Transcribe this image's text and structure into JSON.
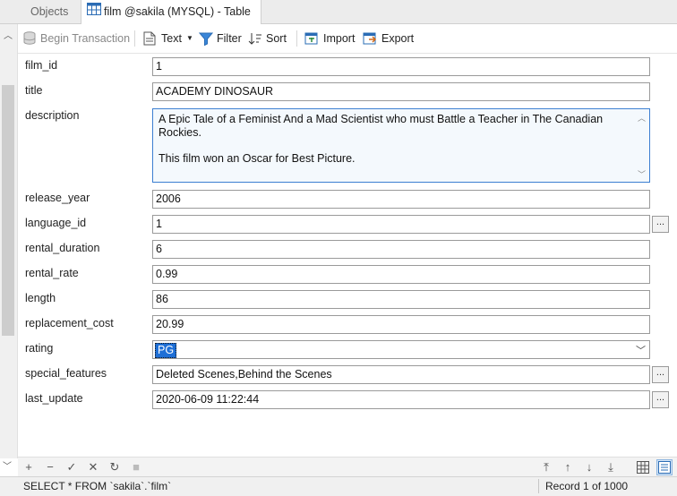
{
  "tabs": {
    "objects": "Objects",
    "film": "film @sakila (MYSQL) - Table"
  },
  "toolbar": {
    "begin_transaction": "Begin Transaction",
    "text": "Text",
    "filter": "Filter",
    "sort": "Sort",
    "import": "Import",
    "export": "Export"
  },
  "fields": {
    "film_id": {
      "label": "film_id",
      "value": "1"
    },
    "title": {
      "label": "title",
      "value": "ACADEMY DINOSAUR"
    },
    "description": {
      "label": "description",
      "line1": "A Epic Tale of a Feminist And a Mad Scientist who must Battle a Teacher in The Canadian Rockies.",
      "line2": "This film won an Oscar for Best Picture."
    },
    "release_year": {
      "label": "release_year",
      "value": "2006"
    },
    "language_id": {
      "label": "language_id",
      "value": "1"
    },
    "rental_duration": {
      "label": "rental_duration",
      "value": "6"
    },
    "rental_rate": {
      "label": "rental_rate",
      "value": "0.99"
    },
    "length": {
      "label": "length",
      "value": "86"
    },
    "replacement_cost": {
      "label": "replacement_cost",
      "value": "20.99"
    },
    "rating": {
      "label": "rating",
      "value": "PG"
    },
    "special_features": {
      "label": "special_features",
      "value": "Deleted Scenes,Behind the Scenes"
    },
    "last_update": {
      "label": "last_update",
      "value": "2020-06-09 11:22:44"
    }
  },
  "ellipsis_label": "...",
  "status": {
    "sql": "SELECT * FROM `sakila`.`film`",
    "record": "Record 1 of 1000"
  },
  "colors": {
    "accent": "#1e6fd6",
    "focus_border": "#3c7fd1"
  }
}
